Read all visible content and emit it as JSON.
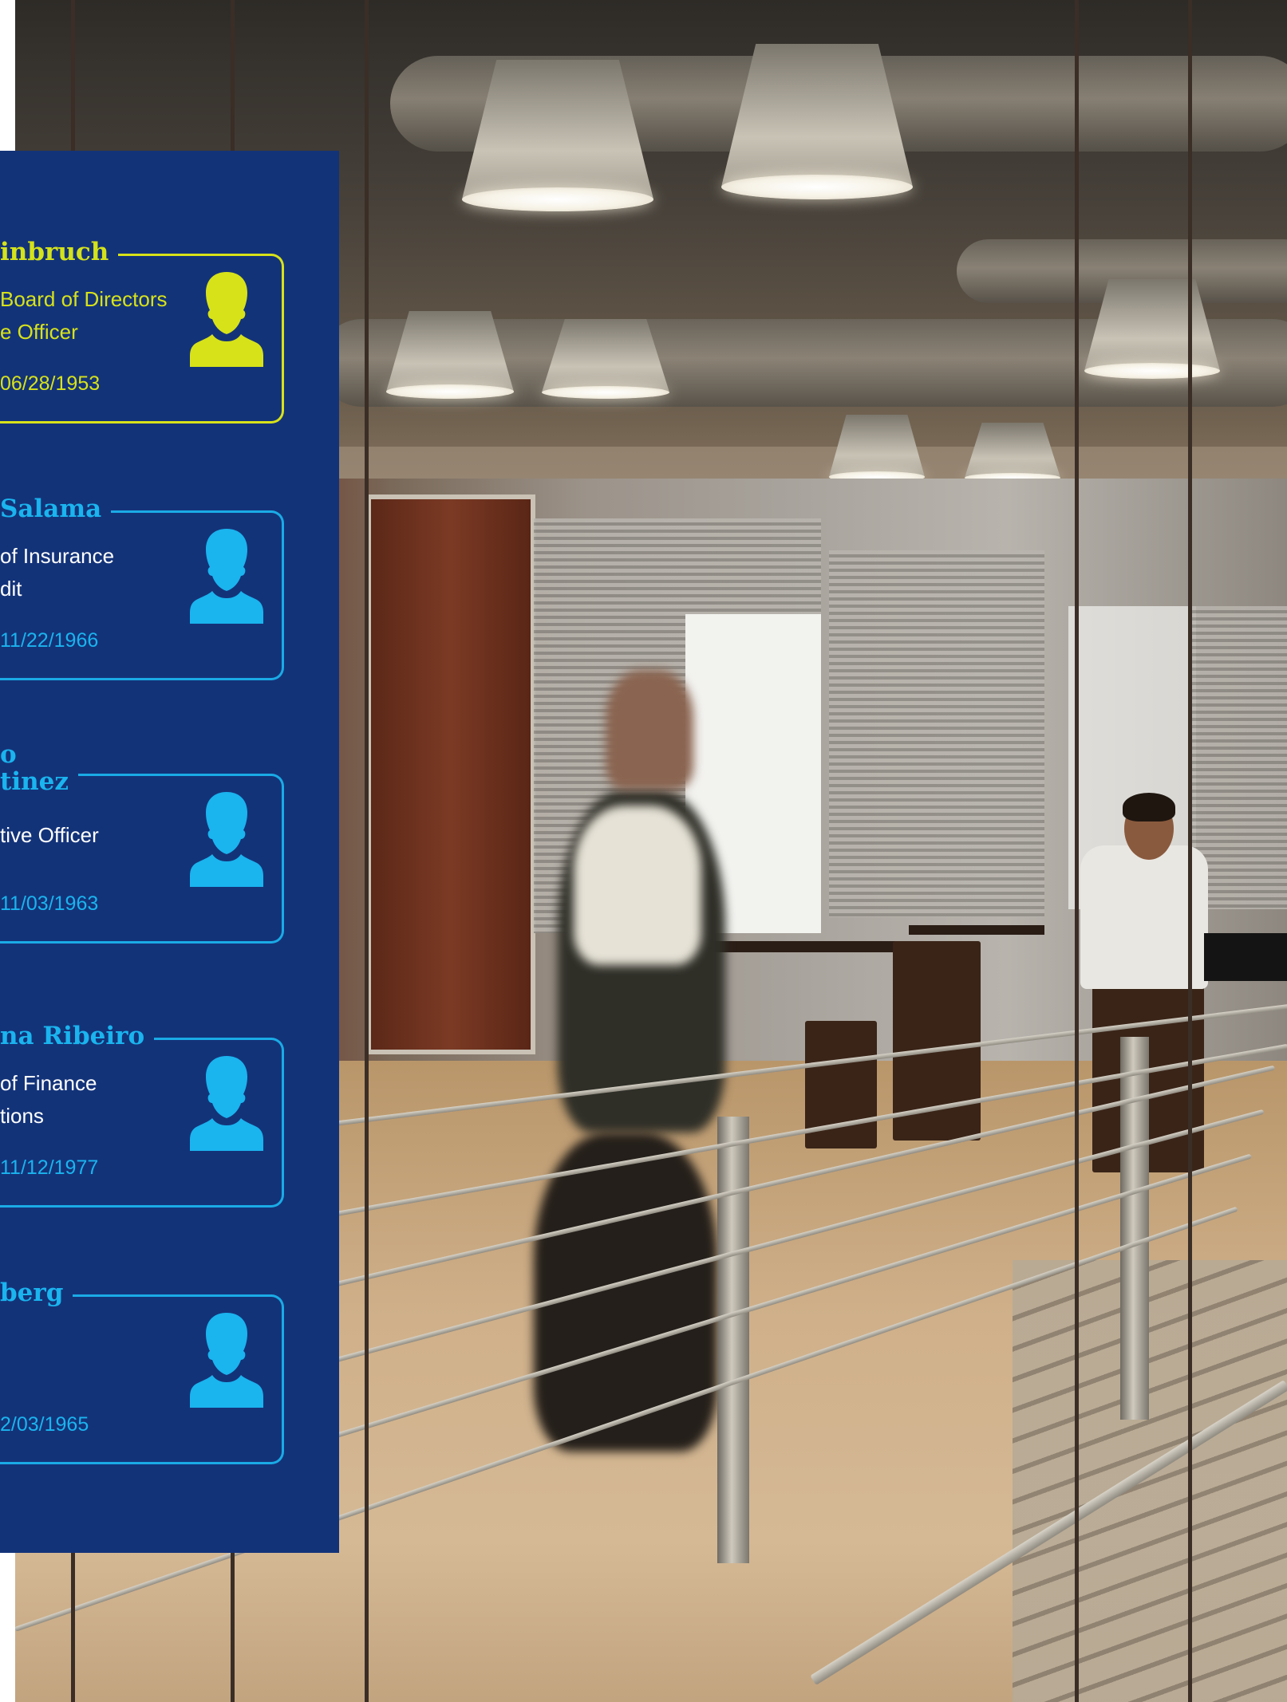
{
  "colors": {
    "panel_background": "#133379",
    "highlight": "#d7e219",
    "accent": "#1ab4ef",
    "text": "#ffffff"
  },
  "icons": {
    "avatar": "person-silhouette-icon"
  },
  "profiles": [
    {
      "name": "inbruch",
      "role": "Board of Directors\ne Officer",
      "date": "06/28/1953",
      "style": "highlight"
    },
    {
      "name": "Salama",
      "role": "of Insurance\ndit",
      "date": "11/22/1966",
      "style": "accent"
    },
    {
      "name": "o\ntinez",
      "role": "tive Officer",
      "date": "11/03/1963",
      "style": "accent"
    },
    {
      "name": "na Ribeiro",
      "role": "of Finance\ntions",
      "date": "11/12/1977",
      "style": "accent"
    },
    {
      "name": "berg",
      "role": "",
      "date": "2/03/1965",
      "style": "accent"
    }
  ]
}
